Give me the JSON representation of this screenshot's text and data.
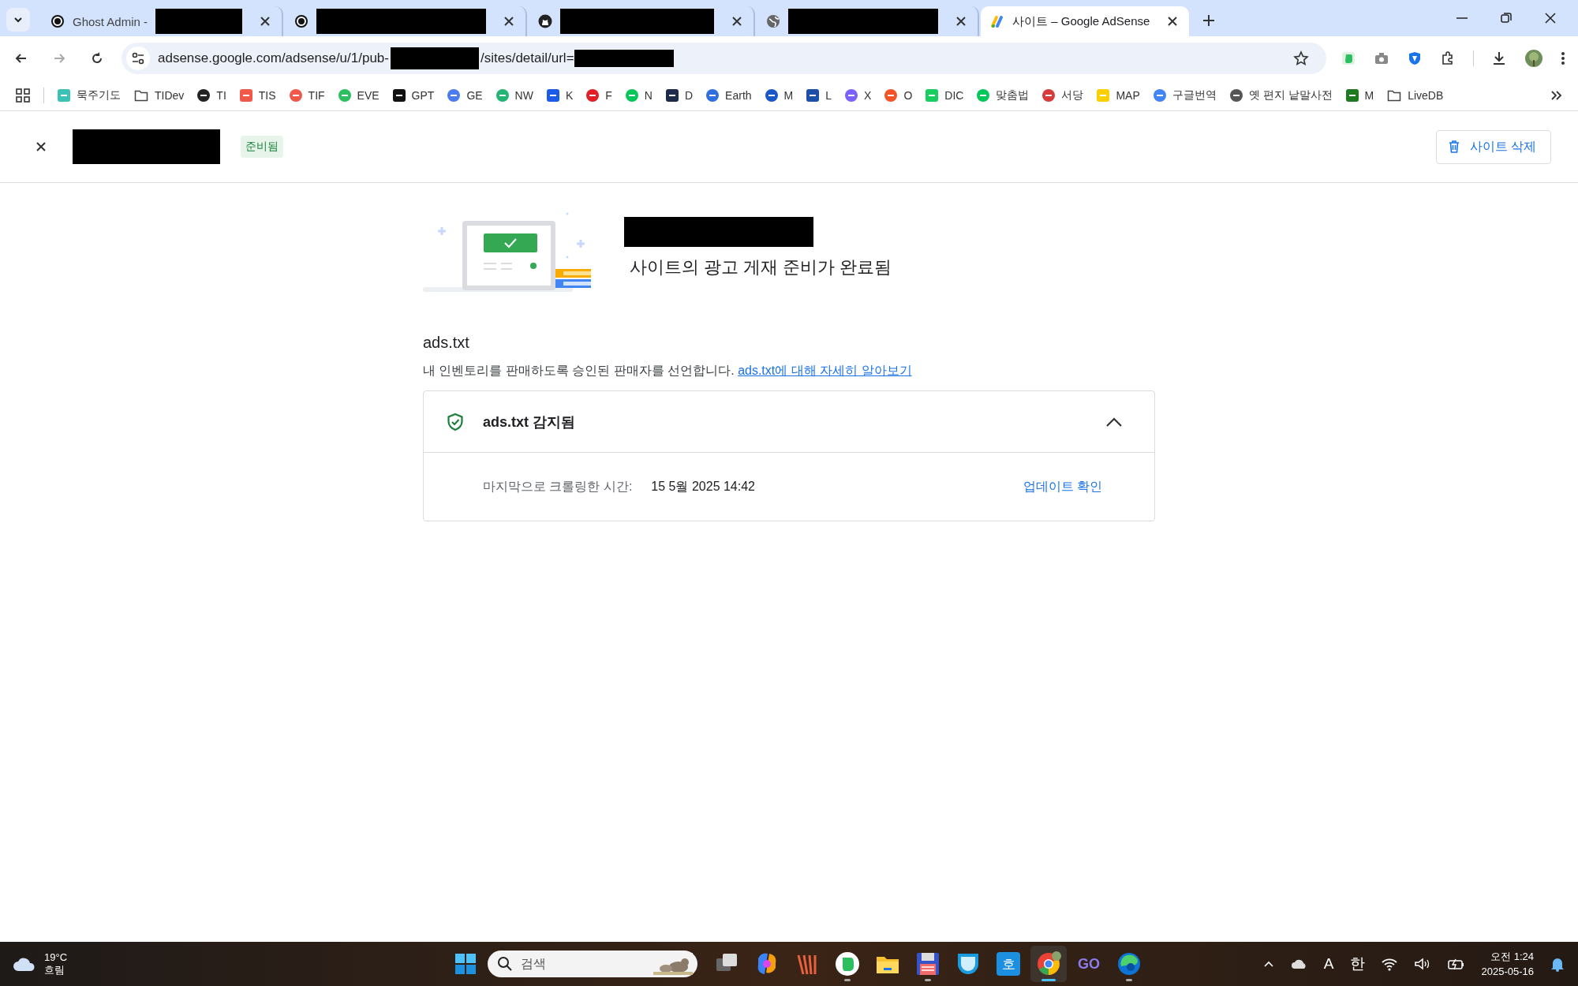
{
  "tabs": [
    {
      "kind": "ghost",
      "title": "Ghost Admin -",
      "redacted": true,
      "selected": false
    },
    {
      "kind": "ghost",
      "redacted": true,
      "selected": false
    },
    {
      "kind": "github",
      "redacted": true,
      "selected": false
    },
    {
      "kind": "globe",
      "redacted": true,
      "selected": false
    },
    {
      "kind": "adsense",
      "title": "사이트 – Google AdSense",
      "redacted": false,
      "selected": true
    }
  ],
  "address_bar": {
    "url_parts": [
      "adsense.google.com/adsense/u/1/pub-",
      "/sites/detail/url="
    ]
  },
  "bookmarks": [
    {
      "kind": "site",
      "label": "묵주기도"
    },
    {
      "kind": "folder",
      "label": "TIDev"
    },
    {
      "kind": "site",
      "label": "TI"
    },
    {
      "kind": "site",
      "label": "TIS"
    },
    {
      "kind": "site",
      "label": "TIF"
    },
    {
      "kind": "site",
      "label": "EVE"
    },
    {
      "kind": "site",
      "label": "GPT"
    },
    {
      "kind": "site",
      "label": "GE"
    },
    {
      "kind": "site",
      "label": "NW"
    },
    {
      "kind": "site",
      "label": "K"
    },
    {
      "kind": "site",
      "label": "F"
    },
    {
      "kind": "site",
      "label": "N"
    },
    {
      "kind": "site",
      "label": "D"
    },
    {
      "kind": "site",
      "label": "Earth"
    },
    {
      "kind": "site",
      "label": "M"
    },
    {
      "kind": "site",
      "label": "L"
    },
    {
      "kind": "site",
      "label": "X"
    },
    {
      "kind": "site",
      "label": "O"
    },
    {
      "kind": "site",
      "label": "DIC"
    },
    {
      "kind": "site",
      "label": "맞춤법"
    },
    {
      "kind": "site",
      "label": "서당"
    },
    {
      "kind": "site",
      "label": "MAP"
    },
    {
      "kind": "site",
      "label": "구글번역"
    },
    {
      "kind": "site",
      "label": "옛 편지 낱말사전"
    },
    {
      "kind": "site",
      "label": "M"
    },
    {
      "kind": "folder",
      "label": "LiveDB"
    }
  ],
  "header": {
    "status_badge": "준비됨",
    "delete_button": "사이트 삭제"
  },
  "hero": {
    "subtitle": "사이트의 광고 게재 준비가 완료됨"
  },
  "section": {
    "title": "ads.txt",
    "description": "내 인벤토리를 판매하도록 승인된 판매자를 선언합니다. ",
    "link": "ads.txt에 대해 자세히 알아보기"
  },
  "card": {
    "title": "ads.txt 감지됨",
    "expanded": true,
    "row_label": "마지막으로 크롤링한 시간:",
    "row_value": "15 5월 2025 14:42",
    "action": "업데이트 확인"
  },
  "taskbar": {
    "weather_temp": "19°C",
    "weather_text": "흐림",
    "search_placeholder": "검색",
    "apps": [
      {
        "kind": "taskview",
        "running": false,
        "selected": false
      },
      {
        "kind": "copilot",
        "running": false,
        "selected": false
      },
      {
        "kind": "stripes",
        "running": false,
        "selected": false
      },
      {
        "kind": "evernote",
        "running": true,
        "selected": false
      },
      {
        "kind": "folder",
        "running": false,
        "selected": false
      },
      {
        "kind": "floppy",
        "running": true,
        "selected": false
      },
      {
        "kind": "shield",
        "running": false,
        "selected": false
      },
      {
        "kind": "square",
        "label": "호",
        "running": false,
        "selected": false
      },
      {
        "kind": "chrome",
        "running": true,
        "selected": true
      },
      {
        "kind": "text",
        "label": "GO",
        "running": false,
        "selected": false
      },
      {
        "kind": "edge",
        "running": true,
        "selected": false
      }
    ],
    "tray": [
      "A",
      "한"
    ],
    "time": "오전 1:24",
    "date": "2025-05-16"
  }
}
